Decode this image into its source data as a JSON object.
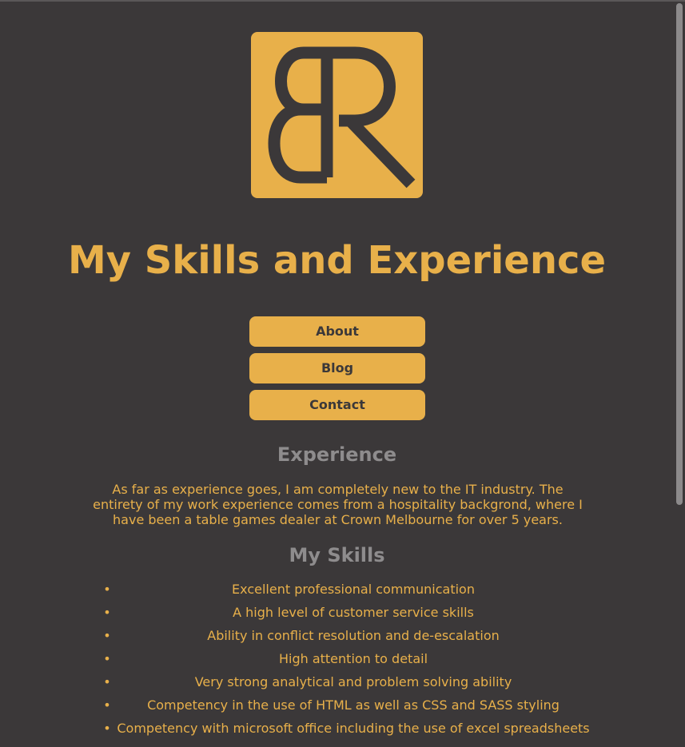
{
  "header": {
    "title": "My Skills and Experience"
  },
  "nav": {
    "items": [
      {
        "label": "About"
      },
      {
        "label": "Blog"
      },
      {
        "label": "Contact"
      }
    ]
  },
  "experience": {
    "heading": "Experience",
    "text": "As far as experience goes, I am completely new to the IT industry. The entirety of my work experience comes from a hospitality backgrond, where I have been a table games dealer at Crown Melbourne for over 5 years."
  },
  "skills": {
    "heading": "My Skills",
    "items": [
      "Excellent professional communication",
      "A high level of customer service skills",
      "Ability in conflict resolution and de-escalation",
      "High attention to detail",
      "Very strong analytical and problem solving ability",
      "Competency in the use of HTML as well as CSS and SASS styling",
      "Competency with microsoft office including the use of excel spreadsheets"
    ]
  },
  "logo": {
    "letters": "BR",
    "icon": "br-monogram-logo"
  },
  "colors": {
    "background": "#3b3839",
    "accent": "#e8b04a",
    "heading_gray": "#8e8c8d"
  }
}
